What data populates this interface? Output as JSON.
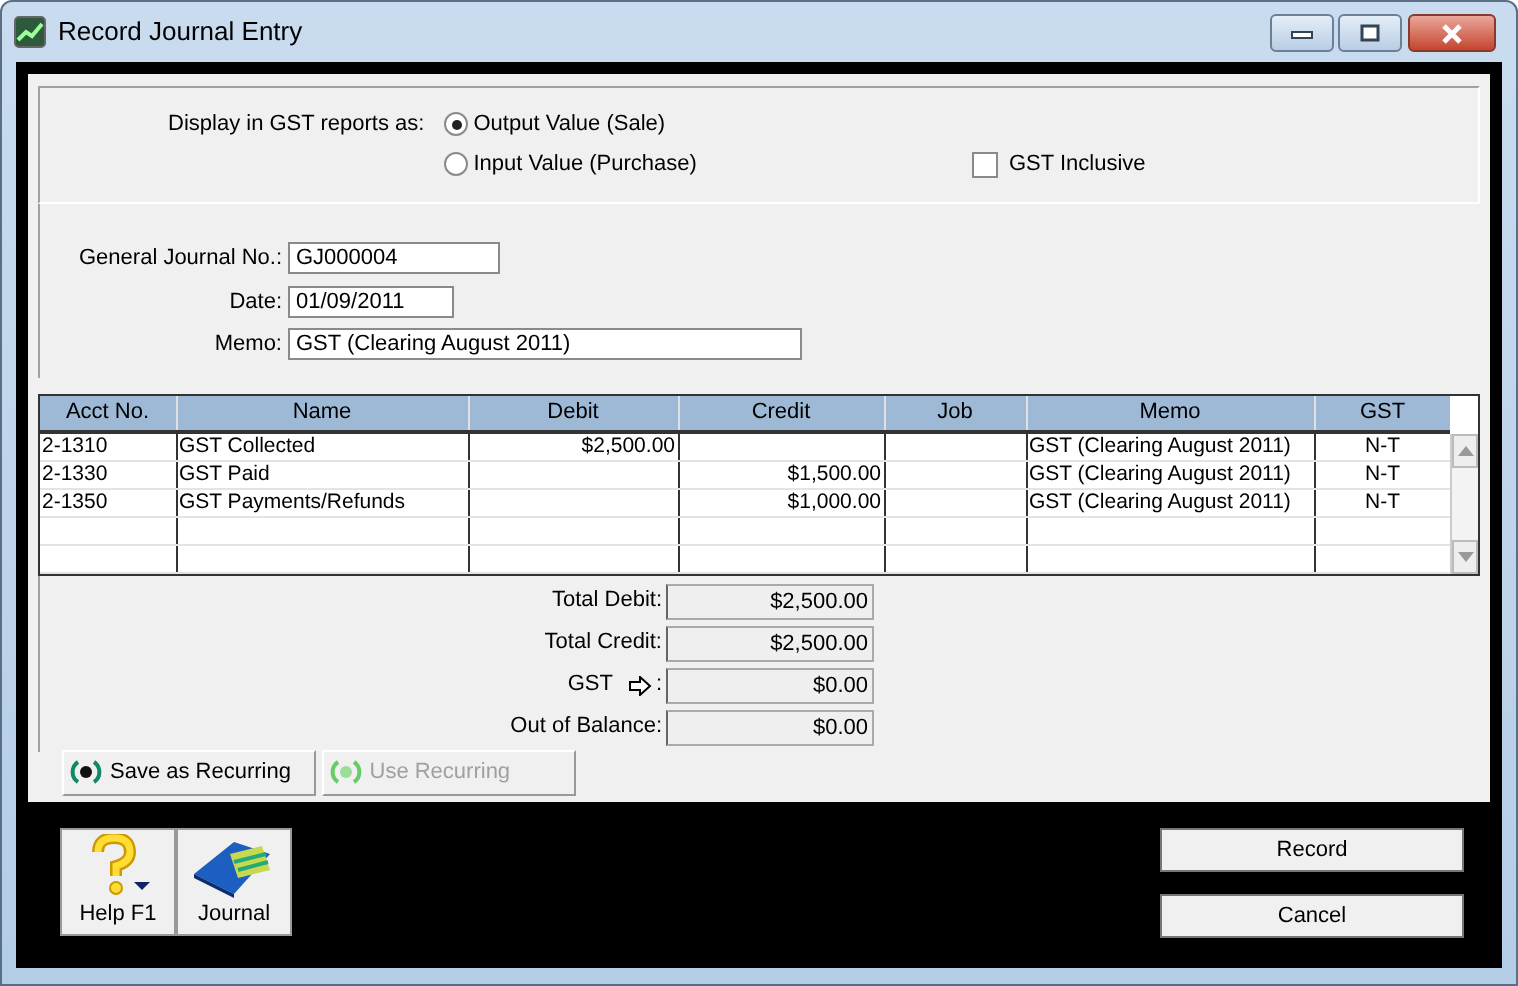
{
  "window": {
    "title": "Record Journal Entry"
  },
  "gst_display": {
    "label": "Display in GST reports as:",
    "options": [
      {
        "label": "Output Value (Sale)",
        "selected": true
      },
      {
        "label": "Input Value (Purchase)",
        "selected": false
      }
    ]
  },
  "gst_inclusive": {
    "label": "GST Inclusive",
    "checked": false
  },
  "fields": [
    {
      "label": "General Journal  No.:",
      "value": "GJ000004"
    },
    {
      "label": "Date:",
      "value": "01/09/2011"
    },
    {
      "label": "Memo:",
      "value": "GST (Clearing August 2011)"
    }
  ],
  "table": {
    "columns": [
      "Acct  No.",
      "Name",
      "Debit",
      "Credit",
      "Job",
      "Memo",
      "GST"
    ],
    "rows": [
      {
        "acct": "2-1310",
        "name": "GST Collected",
        "debit": "$2,500.00",
        "memo": "GST (Clearing August 2011)",
        "gst": "N-T"
      },
      {
        "acct": "2-1330",
        "name": "GST Paid",
        "credit": "$1,500.00",
        "memo": "GST (Clearing August 2011)",
        "gst": "N-T"
      },
      {
        "acct": "2-1350",
        "name": "GST Payments/Refunds",
        "credit": "$1,000.00",
        "memo": "GST (Clearing August 2011)",
        "gst": "N-T"
      }
    ]
  },
  "totals": [
    {
      "label": "Total Debit:",
      "value": "$2,500.00",
      "kind": "plain"
    },
    {
      "label": "Total Credit:",
      "value": "$2,500.00",
      "kind": "plain"
    },
    {
      "label": "GST",
      "suffix": ":",
      "value": "$0.00",
      "kind": "link"
    },
    {
      "label": "Out of Balance:",
      "value": "$0.00",
      "kind": "plain"
    }
  ],
  "recurring_buttons": [
    {
      "label": "Save as Recurring",
      "disabled": false
    },
    {
      "label": "Use Recurring",
      "disabled": true
    }
  ],
  "toolbar": [
    {
      "label": "Help F1",
      "kind": "help"
    },
    {
      "label": "Journal",
      "kind": "journal"
    }
  ],
  "actions": [
    "Record",
    "Cancel"
  ]
}
